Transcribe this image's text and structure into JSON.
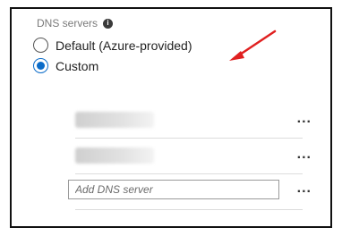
{
  "dns": {
    "heading": "DNS servers",
    "info_icon_glyph": "i",
    "option_default": "Default (Azure-provided)",
    "option_custom": "Custom",
    "selected": "Custom",
    "add_placeholder": "Add DNS server",
    "more_glyph": "...",
    "arrow_color": "#e02020",
    "accent_color": "#0b6cc9"
  }
}
